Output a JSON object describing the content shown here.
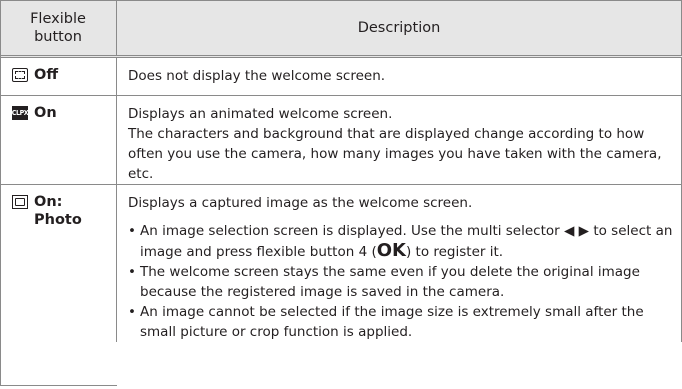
{
  "table": {
    "headers": {
      "button": "Flexible button",
      "description": "Description"
    },
    "rows": [
      {
        "icon": "frame-off-icon",
        "label": "Off",
        "description": "Does not display the welcome screen."
      },
      {
        "icon": "clip-icon",
        "label": "On",
        "description": [
          "Displays an animated welcome screen.",
          "The characters and background that are displayed change according to how often you use the camera, how many images you have taken with the camera, etc."
        ]
      },
      {
        "icon": "photo-icon",
        "label": "On: Photo",
        "intro": "Displays a captured image as the welcome screen.",
        "bullets": [
          "An image selection screen is displayed. Use the multi selector ◀ ▶ to select an image and press flexible button 4 (OK) to register it.",
          "The welcome screen stays the same even if you delete the original image because the registered image is saved in the camera.",
          "An image cannot be selected if the image size is extremely small after the small picture or crop function is applied."
        ]
      }
    ]
  }
}
